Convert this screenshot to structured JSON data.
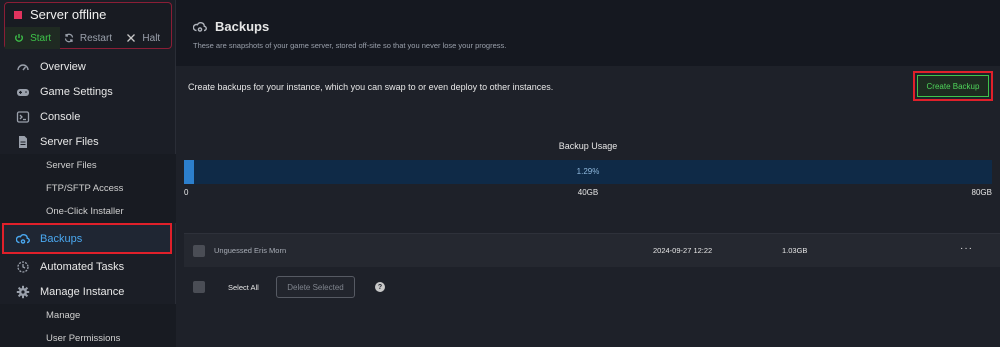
{
  "server": {
    "status": "Server offline",
    "start_label": "Start",
    "restart_label": "Restart",
    "halt_label": "Halt"
  },
  "sidebar": {
    "items": [
      {
        "label": "Overview",
        "icon": "speedometer-icon"
      },
      {
        "label": "Game Settings",
        "icon": "gamepad-icon"
      },
      {
        "label": "Console",
        "icon": "terminal-icon"
      },
      {
        "label": "Server Files",
        "icon": "file-icon"
      }
    ],
    "server_files_sub": [
      "Server Files",
      "FTP/SFTP Access",
      "One-Click Installer"
    ],
    "backups_label": "Backups",
    "automated_tasks_label": "Automated Tasks",
    "manage_instance_label": "Manage Instance",
    "manage_sub": [
      "Manage",
      "User Permissions"
    ]
  },
  "header": {
    "title": "Backups",
    "subtitle": "These are snapshots of your game server, stored off-site so that you never lose your progress."
  },
  "panel": {
    "description": "Create backups for your instance, which you can swap to or even deploy to other instances.",
    "create_button": "Create Backup"
  },
  "usage": {
    "title": "Backup Usage",
    "percent_label": "1.29%",
    "fraction": 0.0129,
    "min_label": "0",
    "mid_label": "40GB",
    "max_label": "80GB"
  },
  "backups": [
    {
      "name": "Unguessed Eris Morn",
      "date": "2024-09-27 12:22",
      "size": "1.03GB",
      "menu": "···"
    }
  ],
  "footer": {
    "select_all": "Select All",
    "delete_selected": "Delete Selected",
    "help": "?"
  },
  "colors": {
    "accent_blue": "#4aa8f0",
    "success_green": "#3ec44a",
    "offline_red": "#e0335e"
  }
}
